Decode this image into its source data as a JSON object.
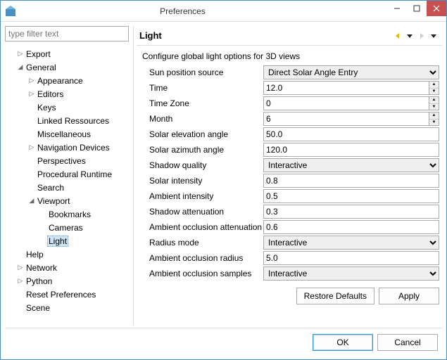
{
  "window": {
    "title": "Preferences"
  },
  "filter": {
    "placeholder": "type filter text"
  },
  "tree": {
    "items": [
      {
        "label": "Export",
        "level": 1,
        "tw": "closed",
        "sel": false
      },
      {
        "label": "General",
        "level": 1,
        "tw": "open",
        "sel": false
      },
      {
        "label": "Appearance",
        "level": 2,
        "tw": "closed",
        "sel": false
      },
      {
        "label": "Editors",
        "level": 2,
        "tw": "closed",
        "sel": false
      },
      {
        "label": "Keys",
        "level": 2,
        "tw": "",
        "sel": false
      },
      {
        "label": "Linked Ressources",
        "level": 2,
        "tw": "",
        "sel": false
      },
      {
        "label": "Miscellaneous",
        "level": 2,
        "tw": "",
        "sel": false
      },
      {
        "label": "Navigation Devices",
        "level": 2,
        "tw": "closed",
        "sel": false
      },
      {
        "label": "Perspectives",
        "level": 2,
        "tw": "",
        "sel": false
      },
      {
        "label": "Procedural Runtime",
        "level": 2,
        "tw": "",
        "sel": false
      },
      {
        "label": "Search",
        "level": 2,
        "tw": "",
        "sel": false
      },
      {
        "label": "Viewport",
        "level": 2,
        "tw": "open",
        "sel": false
      },
      {
        "label": "Bookmarks",
        "level": 3,
        "tw": "",
        "sel": false
      },
      {
        "label": "Cameras",
        "level": 3,
        "tw": "",
        "sel": false
      },
      {
        "label": "Light",
        "level": 3,
        "tw": "",
        "sel": true
      },
      {
        "label": "Help",
        "level": 1,
        "tw": "",
        "sel": false
      },
      {
        "label": "Network",
        "level": 1,
        "tw": "closed",
        "sel": false
      },
      {
        "label": "Python",
        "level": 1,
        "tw": "closed",
        "sel": false
      },
      {
        "label": "Reset Preferences",
        "level": 1,
        "tw": "",
        "sel": false
      },
      {
        "label": "Scene",
        "level": 1,
        "tw": "",
        "sel": false
      }
    ]
  },
  "page": {
    "heading": "Light",
    "description": "Configure global light options for 3D views",
    "settings": [
      {
        "label": "Sun position source",
        "type": "select",
        "value": "Direct Solar Angle Entry"
      },
      {
        "label": "Time",
        "type": "spinner",
        "value": "12.0"
      },
      {
        "label": "Time Zone",
        "type": "spinner",
        "value": "0"
      },
      {
        "label": "Month",
        "type": "spinner",
        "value": "6"
      },
      {
        "label": "Solar elevation angle",
        "type": "text",
        "value": "50.0"
      },
      {
        "label": "Solar azimuth angle",
        "type": "text",
        "value": "120.0"
      },
      {
        "label": "Shadow quality",
        "type": "select",
        "value": "Interactive"
      },
      {
        "label": "Solar intensity",
        "type": "text",
        "value": "0.8"
      },
      {
        "label": "Ambient intensity",
        "type": "text",
        "value": "0.5"
      },
      {
        "label": "Shadow attenuation",
        "type": "text",
        "value": "0.3"
      },
      {
        "label": "Ambient occlusion attenuation",
        "type": "text",
        "value": "0.6"
      },
      {
        "label": "Radius mode",
        "type": "select",
        "value": "Interactive"
      },
      {
        "label": "Ambient occlusion radius",
        "type": "text",
        "value": "5.0"
      },
      {
        "label": "Ambient occlusion samples",
        "type": "select",
        "value": "Interactive"
      }
    ]
  },
  "buttons": {
    "restore_defaults": "Restore Defaults",
    "apply": "Apply",
    "ok": "OK",
    "cancel": "Cancel"
  }
}
